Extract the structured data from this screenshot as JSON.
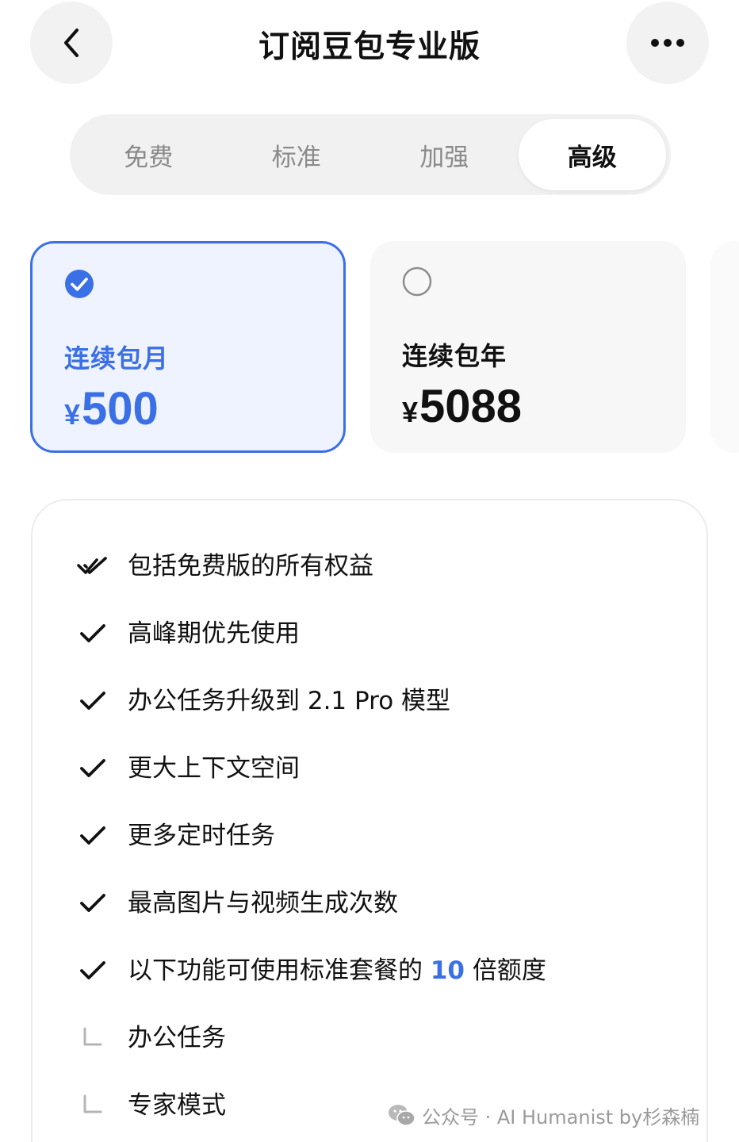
{
  "header": {
    "title": "订阅豆包专业版"
  },
  "tabs": [
    {
      "label": "免费",
      "active": false
    },
    {
      "label": "标准",
      "active": false
    },
    {
      "label": "加强",
      "active": false
    },
    {
      "label": "高级",
      "active": true
    }
  ],
  "plans": [
    {
      "name": "连续包月",
      "currency": "¥",
      "price": "500",
      "selected": true
    },
    {
      "name": "连续包年",
      "currency": "¥",
      "price": "5088",
      "selected": false
    }
  ],
  "features": [
    {
      "text": "包括免费版的所有权益",
      "icon": "double-check-icon"
    },
    {
      "text": "高峰期优先使用",
      "icon": "check-icon"
    },
    {
      "text": "办公任务升级到 2.1 Pro 模型",
      "icon": "check-icon"
    },
    {
      "text": "更大上下文空间",
      "icon": "check-icon"
    },
    {
      "text": "更多定时任务",
      "icon": "check-icon"
    },
    {
      "text": "最高图片与视频生成次数",
      "icon": "check-icon"
    },
    {
      "text_before": "以下功能可使用标准套餐的 ",
      "highlight": "10",
      "text_after": " 倍额度",
      "icon": "check-icon"
    },
    {
      "text": "办公任务",
      "icon": "sub-item-icon"
    },
    {
      "text": "专家模式",
      "icon": "sub-item-icon"
    }
  ],
  "watermark": {
    "text": "公众号 · AI Humanist by杉森楠"
  },
  "colors": {
    "accent": "#3b6fe6",
    "selected_card_bg": "#eef3ff",
    "tab_track": "#f1f1f1"
  }
}
